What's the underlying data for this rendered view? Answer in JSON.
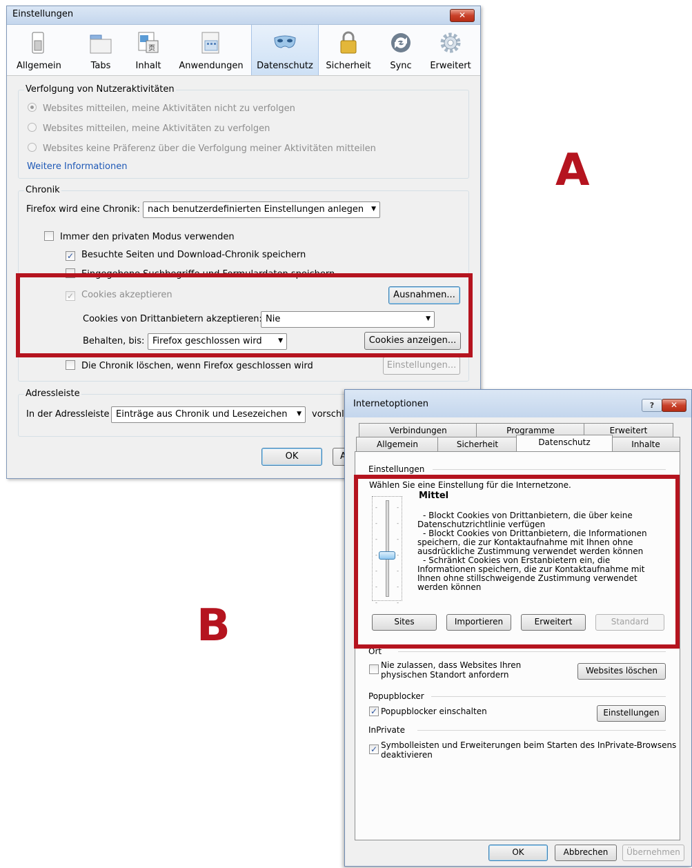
{
  "annotations": {
    "a": "A",
    "b": "B"
  },
  "colors": {
    "highlight": "#b5141f",
    "link": "#1d58b6",
    "title_bar": "#c4d6ed"
  },
  "firefox": {
    "title": "Einstellungen",
    "close_glyph": "✕",
    "toolbar": [
      {
        "label": "Allgemein",
        "icon": "switch-icon"
      },
      {
        "label": "Tabs",
        "icon": "tabs-icon"
      },
      {
        "label": "Inhalt",
        "icon": "content-icon"
      },
      {
        "label": "Anwendungen",
        "icon": "applications-icon"
      },
      {
        "label": "Datenschutz",
        "icon": "mask-icon",
        "selected": true
      },
      {
        "label": "Sicherheit",
        "icon": "padlock-icon"
      },
      {
        "label": "Sync",
        "icon": "sync-icon"
      },
      {
        "label": "Erweitert",
        "icon": "gear-icon"
      }
    ],
    "tracking": {
      "title": "Verfolgung von Nutzeraktivitäten",
      "options": [
        "Websites mitteilen, meine Aktivitäten nicht zu verfolgen",
        "Websites mitteilen, meine Aktivitäten zu verfolgen",
        "Websites keine Präferenz über die Verfolgung meiner Aktivitäten mitteilen"
      ],
      "more_info": "Weitere Informationen"
    },
    "history": {
      "title": "Chronik",
      "mode_label": "Firefox wird eine Chronik:",
      "mode_value": "nach benutzerdefinierten Einstellungen anlegen",
      "private_mode": "Immer den privaten Modus verwenden",
      "remember_history": "Besuchte Seiten und Download-Chronik speichern",
      "remember_forms": "Eingegebene Suchbegriffe und Formulardaten speichern",
      "accept_cookies": "Cookies akzeptieren",
      "exceptions_button": "Ausnahmen...",
      "third_party_label": "Cookies von Drittanbietern akzeptieren:",
      "third_party_value": "Nie",
      "keep_until_label": "Behalten, bis:",
      "keep_until_value": "Firefox geschlossen wird",
      "show_cookies_button": "Cookies anzeigen...",
      "clear_on_close": "Die Chronik löschen, wenn Firefox geschlossen wird",
      "settings_button": "Einstellungen..."
    },
    "addressbar": {
      "title": "Adressleiste",
      "label": "In der Adressleiste",
      "value": "Einträge aus Chronik und Lesezeichen",
      "suffix": "vorschl"
    },
    "ok_button": "OK",
    "cancel_partial": "A"
  },
  "ie": {
    "title": "Internetoptionen",
    "help_glyph": "?",
    "close_glyph": "✕",
    "tabs_back": [
      "Verbindungen",
      "Programme",
      "Erweitert"
    ],
    "tabs_front": [
      "Allgemein",
      "Sicherheit",
      "Datenschutz",
      "Inhalte"
    ],
    "settings_title": "Einstellungen",
    "zone_text": "Wählen Sie eine Einstellung für die Internetzone.",
    "level": "Mittel",
    "level_fraction": 0.4,
    "description": [
      "- Blockt Cookies von Drittanbietern, die über keine",
      "Datenschutzrichtlinie verfügen",
      "- Blockt Cookies von Drittanbietern, die Informationen",
      "speichern, die zur Kontaktaufnahme mit Ihnen ohne",
      "ausdrückliche Zustimmung verwendet werden können",
      "- Schränkt Cookies von Erstanbietern ein, die",
      "Informationen speichern, die zur Kontaktaufnahme mit",
      "Ihnen ohne stillschweigende Zustimmung verwendet",
      "werden können"
    ],
    "buttons": [
      "Sites",
      "Importieren",
      "Erweitert",
      "Standard"
    ],
    "location": {
      "title": "Ort",
      "checkbox_line1": "Nie zulassen, dass Websites Ihren",
      "checkbox_line2": "physischen Standort anfordern",
      "button": "Websites löschen"
    },
    "popup": {
      "title": "Popupblocker",
      "checkbox": "Popupblocker einschalten",
      "button": "Einstellungen"
    },
    "inprivate": {
      "title": "InPrivate",
      "checkbox_line1": "Symbolleisten und Erweiterungen beim Starten des InPrivate-Browsens",
      "checkbox_line2": "deaktivieren"
    },
    "footer": [
      "OK",
      "Abbrechen",
      "Übernehmen"
    ]
  }
}
